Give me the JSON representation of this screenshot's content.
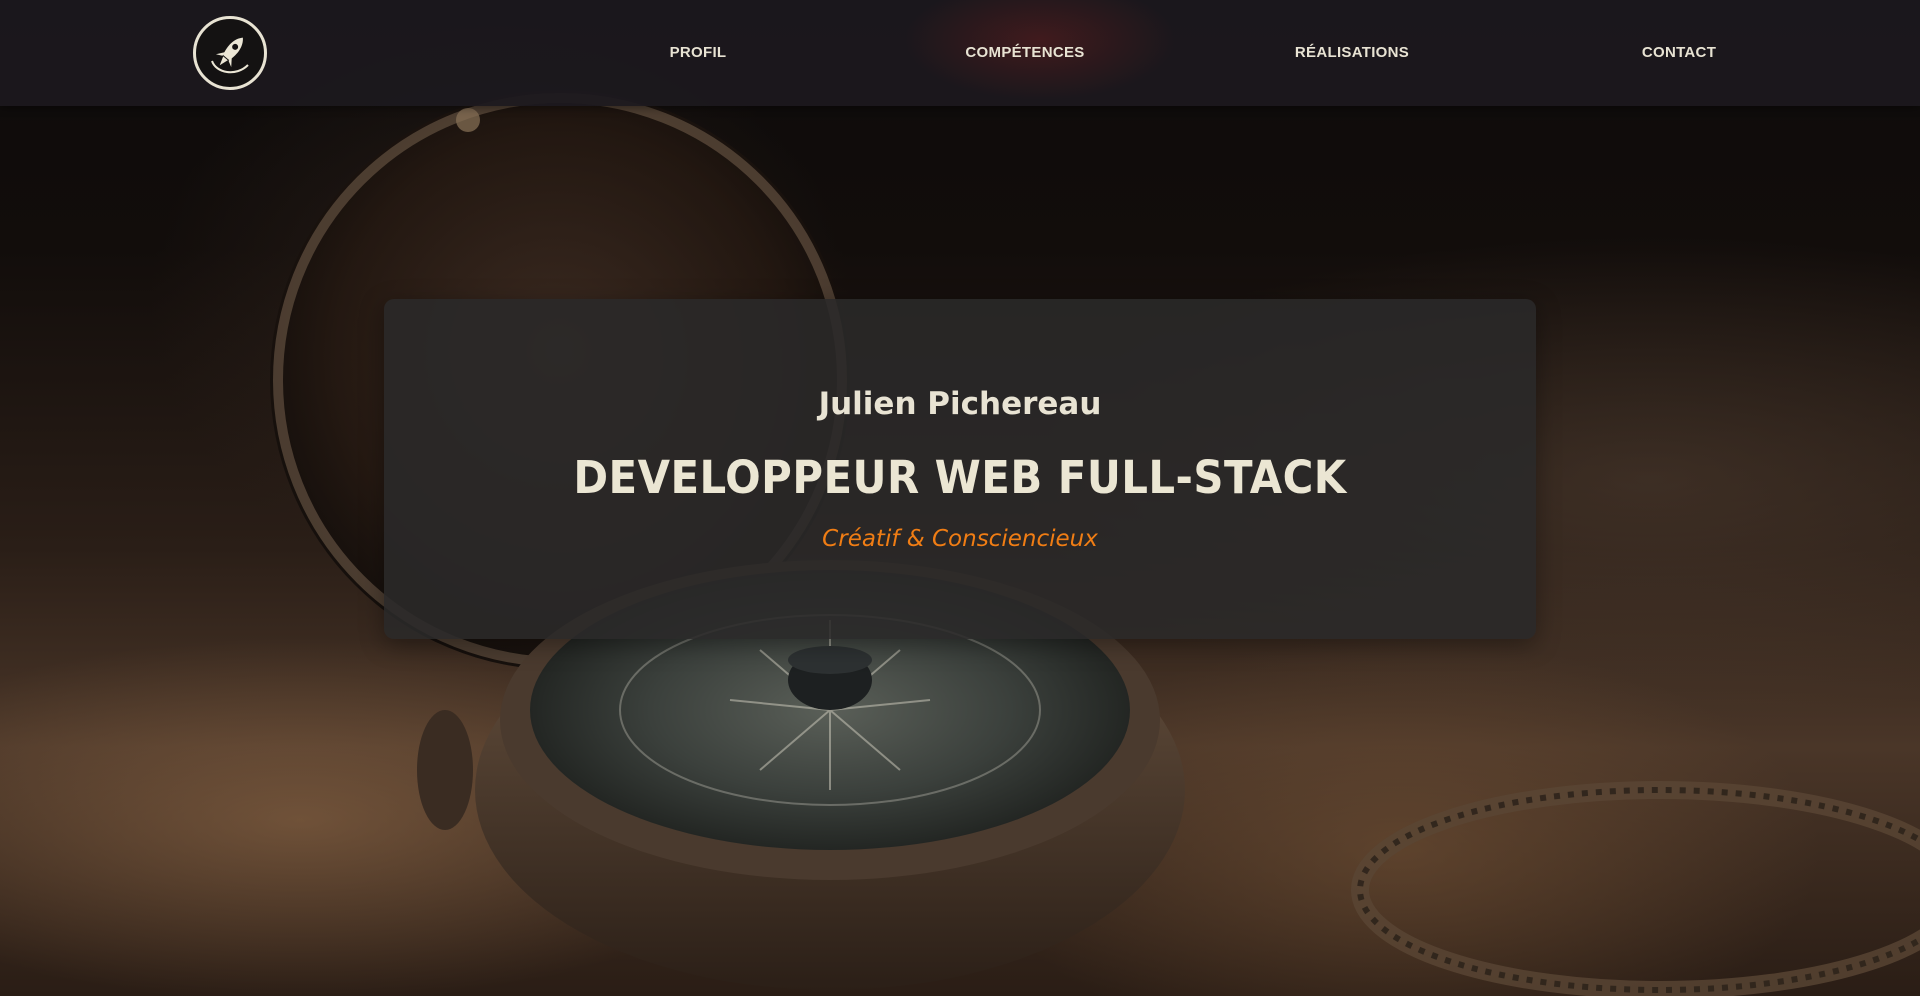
{
  "nav": {
    "logo_icon": "rocket-icon",
    "items": [
      {
        "label": "PROFIL"
      },
      {
        "label": "COMPÉTENCES"
      },
      {
        "label": "RÉALISATIONS"
      },
      {
        "label": "CONTACT"
      }
    ]
  },
  "hero": {
    "name": "Julien Pichereau",
    "title": "DEVELOPPEUR WEB FULL-STACK",
    "tagline": "Créatif & Consciencieux",
    "background_icon": "compass-icon"
  },
  "colors": {
    "navbar_bg": "#1c191e",
    "text_light": "#e8e3d3",
    "accent": "#f07d14",
    "card_bg": "#2a2929"
  }
}
